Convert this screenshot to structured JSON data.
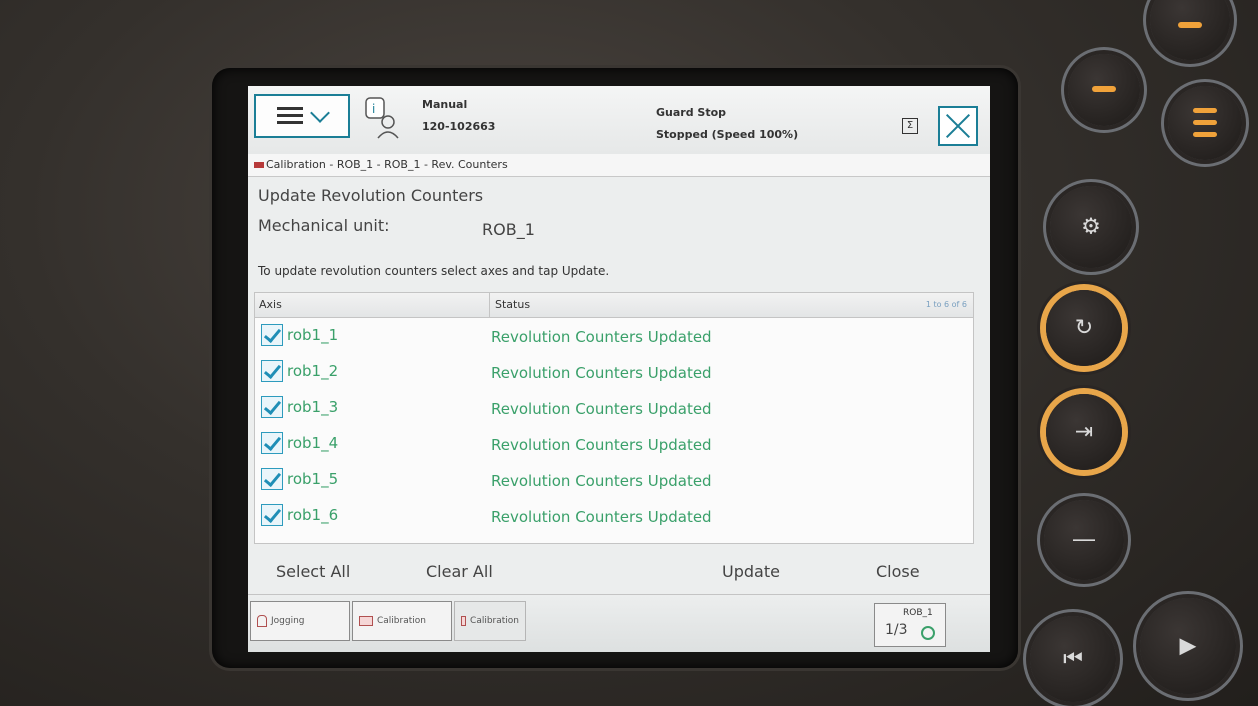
{
  "header": {
    "mode": "Manual",
    "controller_id": "120-102663",
    "safety_state": "Guard Stop",
    "run_state": "Stopped (Speed 100%)"
  },
  "breadcrumb": "Calibration - ROB_1 - ROB_1 - Rev. Counters",
  "page": {
    "title": "Update Revolution Counters",
    "mechanical_unit_label": "Mechanical unit:",
    "mechanical_unit_value": "ROB_1",
    "instruction": "To update revolution counters select axes and tap Update."
  },
  "table": {
    "columns": [
      "Axis",
      "Status"
    ],
    "pager": "1 to 6 of 6",
    "rows": [
      {
        "axis": "rob1_1",
        "status": "Revolution Counters Updated",
        "checked": true
      },
      {
        "axis": "rob1_2",
        "status": "Revolution Counters Updated",
        "checked": true
      },
      {
        "axis": "rob1_3",
        "status": "Revolution Counters Updated",
        "checked": true
      },
      {
        "axis": "rob1_4",
        "status": "Revolution Counters Updated",
        "checked": true
      },
      {
        "axis": "rob1_5",
        "status": "Revolution Counters Updated",
        "checked": true
      },
      {
        "axis": "rob1_6",
        "status": "Revolution Counters Updated",
        "checked": true
      }
    ]
  },
  "actions": {
    "select_all": "Select All",
    "clear_all": "Clear All",
    "update": "Update",
    "close": "Close"
  },
  "taskbar": {
    "items": [
      "Jogging",
      "Calibration",
      "Calibration"
    ],
    "robot_name": "ROB_1",
    "robot_fraction": "1/3"
  }
}
